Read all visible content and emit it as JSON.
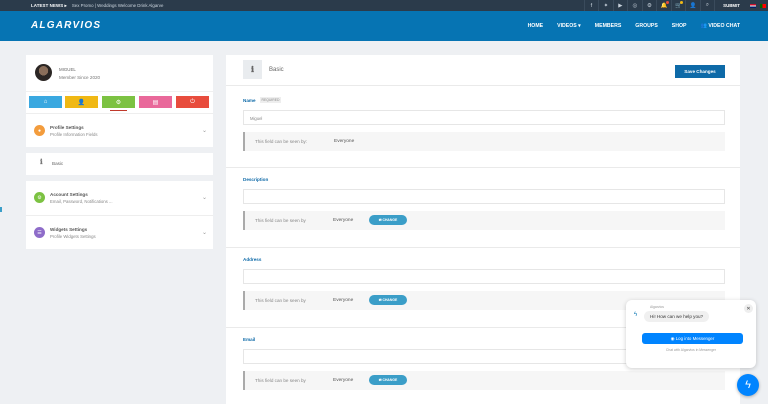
{
  "newsbar": {
    "label": "LATEST NEWS ▸",
    "headline": "Sex Promo | Weddings Welcome Drink Algarve",
    "icons": [
      "facebook-icon",
      "twitter-icon",
      "youtube-icon",
      "instagram-icon",
      "settings-icon",
      "bell-icon",
      "cart-icon",
      "user-add-icon",
      "search-icon"
    ],
    "submit": "SUBMIT"
  },
  "header": {
    "logo": "ALGARVIOS",
    "nav": [
      "HOME",
      "VIDEOS ▾",
      "MEMBERS",
      "GROUPS",
      "SHOP",
      "👥 VIDEO CHAT"
    ]
  },
  "profile": {
    "name": "MIGUEL",
    "since": "Member Since 2020"
  },
  "quick_buttons": [
    {
      "icon": "⌂",
      "color": "#3aa8e0",
      "name": "home-icon"
    },
    {
      "icon": "👤",
      "color": "#f0b814",
      "name": "user-icon"
    },
    {
      "icon": "⚙",
      "color": "#7cc242",
      "name": "settings-icon"
    },
    {
      "icon": "▤",
      "color": "#e9689a",
      "name": "card-icon"
    },
    {
      "icon": "⏻",
      "color": "#e84c3d",
      "name": "power-icon"
    }
  ],
  "menu": {
    "profile_settings": {
      "title": "Profile Settings",
      "sub": "Profile Information Fields",
      "color": "#f39c3c"
    },
    "basic": "Basic",
    "account_settings": {
      "title": "Account Settings",
      "sub": "Email, Password, Notifications ...",
      "color": "#7cc242"
    },
    "widgets_settings": {
      "title": "Widgets Settings",
      "sub": "Profile Widgets Settings",
      "color": "#8e6cc9"
    }
  },
  "main": {
    "title": "Basic",
    "save": "Save Changes",
    "name_label": "Name",
    "required": "REQUIRED",
    "name_value": "Miguel",
    "seen_by_colon": "This field can be seen by:",
    "seen_by": "This field can be seen by",
    "everyone": "Everyone",
    "change": "⇄ CHANGE",
    "description_label": "Description",
    "address_label": "Address",
    "email_label": "Email"
  },
  "messenger": {
    "page_name": "Algarvios",
    "greeting": "Hi! How can we help you?",
    "login": "Log into Messenger",
    "chat_note": "Chat with Algarvios in Messenger"
  }
}
